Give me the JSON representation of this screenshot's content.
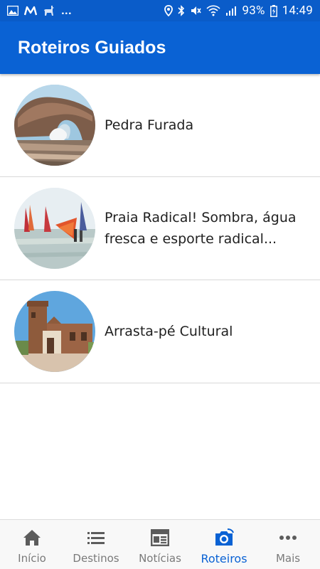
{
  "status_bar": {
    "battery": "93%",
    "time": "14:49",
    "overflow": "...",
    "icons_left": [
      "image-icon",
      "m-logo-icon",
      "llama-icon"
    ],
    "icons_right": [
      "location-icon",
      "bluetooth-icon",
      "mute-icon",
      "wifi-icon",
      "signal-icon",
      "battery-icon"
    ]
  },
  "header": {
    "title": "Roteiros Guiados"
  },
  "items": [
    {
      "title": "Pedra Furada",
      "image": "rock-arch-photo"
    },
    {
      "title": "Praia Radical! Sombra, água fresca e esporte radical...",
      "image": "windsurf-beach-photo"
    },
    {
      "title": "Arrasta-pé Cultural",
      "image": "old-church-photo"
    }
  ],
  "nav": [
    {
      "label": "Início",
      "icon": "home-icon",
      "active": false
    },
    {
      "label": "Destinos",
      "icon": "list-icon",
      "active": false
    },
    {
      "label": "Notícias",
      "icon": "newspaper-icon",
      "active": false
    },
    {
      "label": "Roteiros",
      "icon": "camera-icon",
      "active": true
    },
    {
      "label": "Mais",
      "icon": "more-icon",
      "active": false
    }
  ],
  "colors": {
    "primary": "#0a62d4",
    "status": "#0a5cc9",
    "nav_inactive": "#7a7a7a"
  }
}
